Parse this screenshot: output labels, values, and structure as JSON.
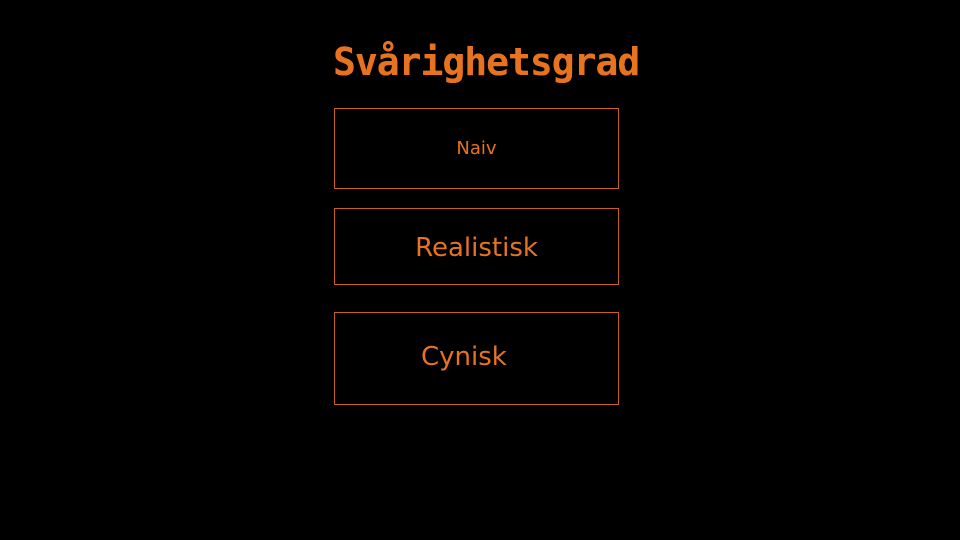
{
  "menu": {
    "title": "Svårighetsgrad",
    "options": [
      {
        "label": "Naiv"
      },
      {
        "label": "Realistisk"
      },
      {
        "label": "Cynisk"
      }
    ]
  },
  "colors": {
    "background": "#000000",
    "accent": "#e8731e",
    "border": "#c8601a"
  }
}
